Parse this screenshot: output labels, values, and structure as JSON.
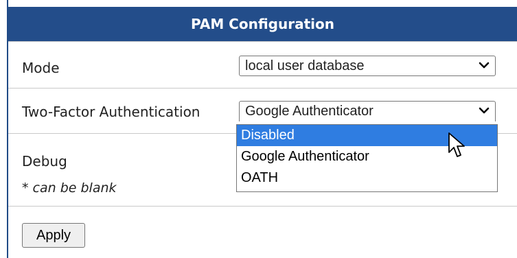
{
  "header": {
    "title": "PAM Configuration"
  },
  "mode": {
    "label": "Mode",
    "value": "local user database"
  },
  "two_factor": {
    "label": "Two-Factor Authentication",
    "value": "Google Authenticator",
    "options": [
      "Disabled",
      "Google Authenticator",
      "OATH"
    ],
    "highlighted": "Disabled"
  },
  "debug": {
    "label": "Debug",
    "hint": "* can be blank"
  },
  "apply": {
    "label": "Apply"
  },
  "colors": {
    "header_bg": "#234d8a",
    "highlight": "#2f7de1"
  },
  "icons": {
    "select_arrow": "chevron-down-icon",
    "pointer": "mouse-pointer-icon"
  }
}
